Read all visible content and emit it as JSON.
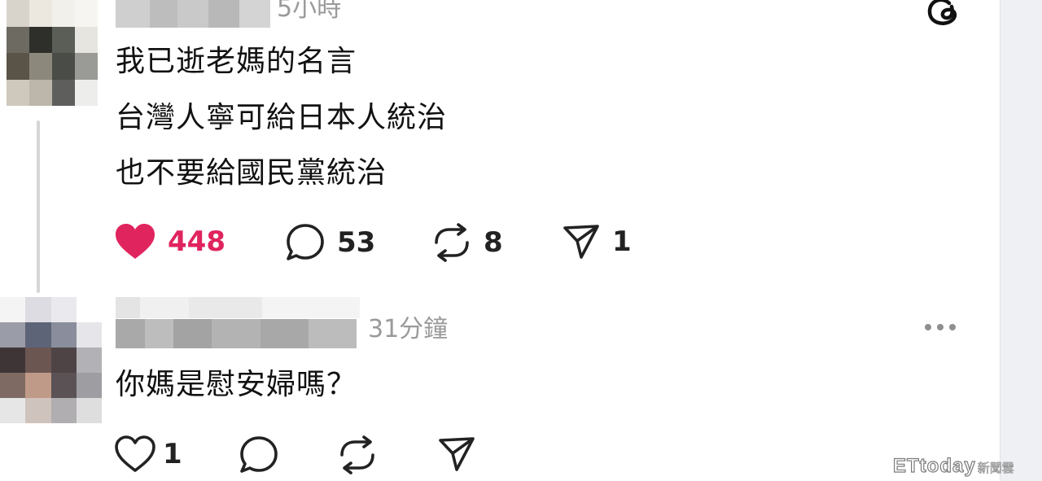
{
  "post": {
    "time": "5小時",
    "lines": [
      "我已逝老媽的名言",
      "台灣人寧可給日本人統治",
      "也不要給國民黨統治"
    ],
    "likes": "448",
    "comments": "53",
    "reposts": "8",
    "shares": "1",
    "like_color": "#e0245e"
  },
  "reply": {
    "time": "31分鐘",
    "text": "你媽是慰安婦嗎？",
    "likes": "1"
  },
  "icons": {
    "brand": "threads-logo-icon",
    "like_filled": "heart-filled-icon",
    "like": "heart-outline-icon",
    "comment": "speech-bubble-icon",
    "repost": "repost-icon",
    "share": "send-icon",
    "menu": "more-dots-icon"
  },
  "watermark": {
    "brand": "ETtoday",
    "suffix": "新聞雲"
  }
}
